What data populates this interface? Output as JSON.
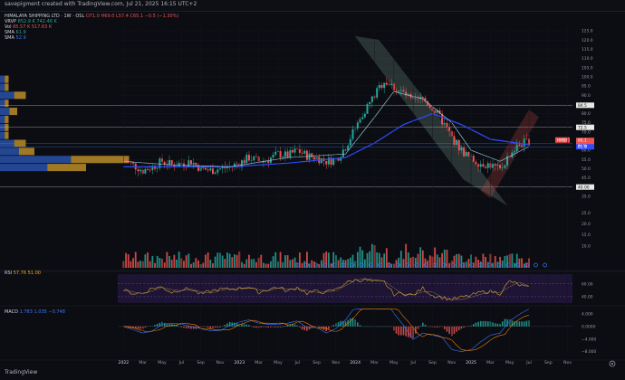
{
  "header": {
    "caption": "savepigment created with TradingView.com, Jul 21, 2025 16:15 UTC+2"
  },
  "legend": {
    "symbol": "HIMALAYA SHIPPING LTD · 1W · OSL",
    "ohlc": "O71.0 H69.0 L57.4 C65.1 −0.5 (−1.30%)",
    "vrvp_label": "VRVP",
    "vrvp_vals": "852.9 K  742.46 K",
    "vol_label": "Vol",
    "vol_vals": "85.57 K  517.63 K",
    "sma1_label": "SMA",
    "sma1_val": "61.9",
    "sma2_label": "SMA",
    "sma2_val": "52.9"
  },
  "rsi_legend": {
    "label": "RSI",
    "vals": "57.76  51.00"
  },
  "macd_legend": {
    "label": "MACD",
    "vals": "1.783  1.035  −0.748"
  },
  "watermark": "TradingView",
  "icon": "chart-settings-icon",
  "chart_data": [
    {
      "type": "candlestick",
      "title": "HIMALAYA SHIPPING LTD · 1W · OSL",
      "x_ticks": [
        "2022",
        "Mar",
        "May",
        "Jul",
        "Sep",
        "Nov",
        "2023",
        "Mar",
        "May",
        "Jul",
        "Sep",
        "Nov",
        "2024",
        "Mar",
        "May",
        "Jul",
        "Sep",
        "Nov",
        "2025",
        "Mar",
        "May",
        "Jul",
        "Sep",
        "Nov"
      ],
      "y_ticks": [
        125,
        120,
        115,
        110,
        105,
        100,
        95,
        90,
        85,
        80,
        75,
        70,
        65,
        60,
        55,
        50,
        45,
        40,
        35
      ],
      "ylim": [
        31,
        127
      ],
      "price_badges": {
        "hmsf": "HMSF",
        "last": "65.1",
        "time": "6d 5h",
        "levels": [
          {
            "label": "84.5",
            "value": 84.5
          },
          {
            "label": "72.5",
            "value": 72.5
          },
          {
            "label": "63.6",
            "value": 63.6
          },
          {
            "label": "61.9",
            "value": 61.9
          },
          {
            "label": "40.00",
            "value": 40.0
          }
        ]
      },
      "horizontal_levels": [
        84.5,
        72.5,
        63.6,
        61.9,
        40.0
      ],
      "annotations": [
        "descending parallel channel",
        "ascending channel"
      ],
      "close_path": [
        [
          "2022-01",
          55
        ],
        [
          "2022-02",
          52
        ],
        [
          "2022-03",
          49
        ],
        [
          "2022-04",
          51
        ],
        [
          "2022-05",
          54
        ],
        [
          "2022-06",
          52
        ],
        [
          "2022-07",
          53
        ],
        [
          "2022-08",
          54
        ],
        [
          "2022-09",
          50
        ],
        [
          "2022-10",
          49
        ],
        [
          "2022-11",
          50
        ],
        [
          "2022-12",
          51
        ],
        [
          "2023-01",
          53
        ],
        [
          "2023-02",
          56
        ],
        [
          "2023-03",
          54
        ],
        [
          "2023-04",
          55
        ],
        [
          "2023-05",
          58
        ],
        [
          "2023-06",
          57
        ],
        [
          "2023-07",
          60
        ],
        [
          "2023-08",
          57
        ],
        [
          "2023-09",
          56
        ],
        [
          "2023-10",
          54
        ],
        [
          "2023-11",
          55
        ],
        [
          "2023-12",
          62
        ],
        [
          "2024-01",
          72
        ],
        [
          "2024-02",
          82
        ],
        [
          "2024-03",
          90
        ],
        [
          "2024-04",
          98
        ],
        [
          "2024-05",
          94
        ],
        [
          "2024-06",
          91
        ],
        [
          "2024-07",
          86
        ],
        [
          "2024-08",
          88
        ],
        [
          "2024-09",
          83
        ],
        [
          "2024-10",
          76
        ],
        [
          "2024-11",
          67
        ],
        [
          "2024-12",
          60
        ],
        [
          "2025-01",
          55
        ],
        [
          "2025-02",
          53
        ],
        [
          "2025-03",
          52
        ],
        [
          "2025-04",
          49
        ],
        [
          "2025-05",
          58
        ],
        [
          "2025-06",
          63
        ],
        [
          "2025-07",
          65
        ]
      ],
      "sma_fast": [
        [
          "2022-01",
          54
        ],
        [
          "2022-06",
          52
        ],
        [
          "2022-12",
          51
        ],
        [
          "2023-06",
          56
        ],
        [
          "2023-12",
          58
        ],
        [
          "2024-03",
          78
        ],
        [
          "2024-05",
          92
        ],
        [
          "2024-08",
          88
        ],
        [
          "2024-11",
          75
        ],
        [
          "2025-01",
          60
        ],
        [
          "2025-04",
          54
        ],
        [
          "2025-07",
          62
        ]
      ],
      "sma_slow": [
        [
          "2022-01",
          51
        ],
        [
          "2022-12",
          51
        ],
        [
          "2023-06",
          53
        ],
        [
          "2023-12",
          56
        ],
        [
          "2024-03",
          64
        ],
        [
          "2024-06",
          74
        ],
        [
          "2024-09",
          80
        ],
        [
          "2024-12",
          74
        ],
        [
          "2025-03",
          66
        ],
        [
          "2025-07",
          63
        ]
      ]
    },
    {
      "type": "bar",
      "title": "",
      "ylabel": "Vol",
      "note": "weekly volume histogram",
      "y_ticks": [
        25,
        20,
        15,
        10
      ]
    },
    {
      "type": "line",
      "title": "RSI",
      "y_ticks": [
        60,
        40
      ],
      "ylim": [
        30,
        75
      ]
    },
    {
      "type": "histogram",
      "title": "MACD",
      "y_ticks": [
        "4.000",
        "0.0000",
        "−4.000",
        "−8.000"
      ],
      "ylim": [
        -9,
        6
      ]
    }
  ]
}
